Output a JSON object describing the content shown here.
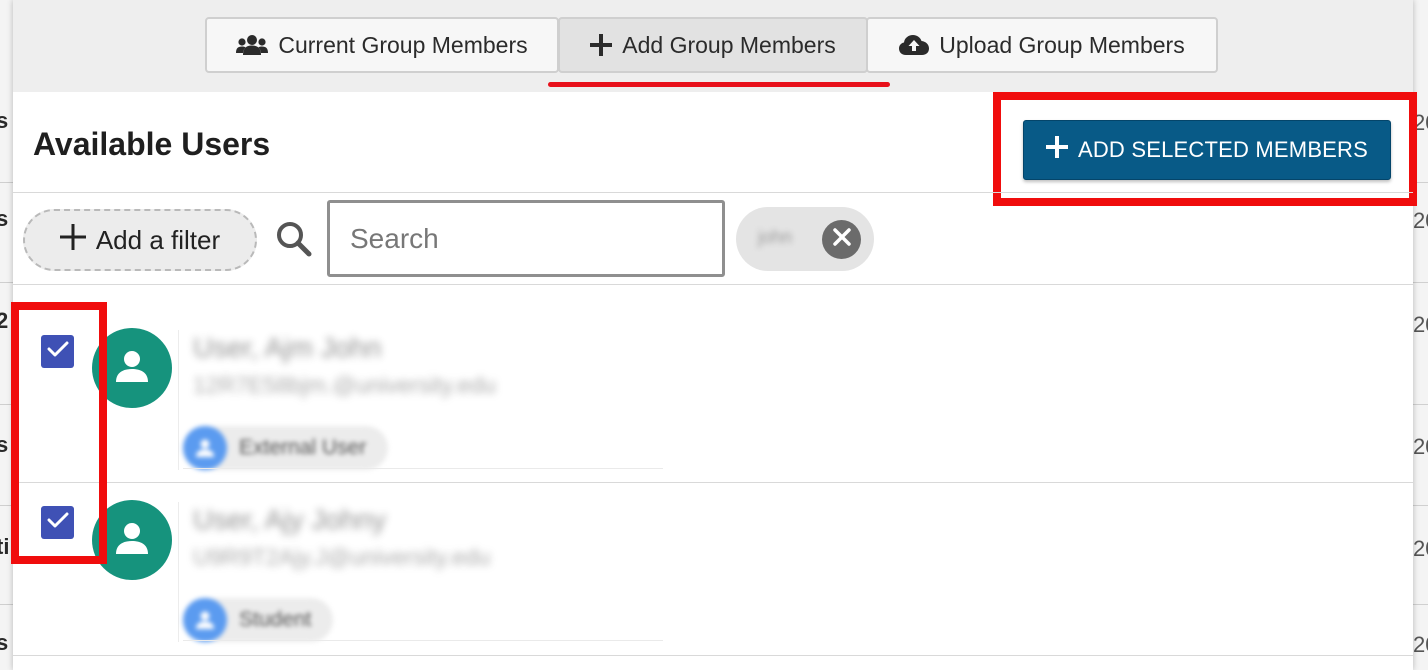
{
  "background": {
    "left_fragments": [
      "s",
      "s",
      "2",
      "s",
      "ti",
      "s"
    ],
    "right_fragments": [
      "20",
      "20",
      "20",
      "20",
      "20",
      "20"
    ]
  },
  "tabs": [
    {
      "label": "Current Group Members",
      "icon": "users-icon",
      "active": false
    },
    {
      "label": "Add Group Members",
      "icon": "plus-icon",
      "active": true
    },
    {
      "label": "Upload Group Members",
      "icon": "cloud-upload-icon",
      "active": false
    }
  ],
  "header": {
    "title": "Available Users",
    "add_selected_label": "ADD SELECTED MEMBERS"
  },
  "filters": {
    "add_filter_label": "Add a filter",
    "search_placeholder": "Search",
    "search_value": "",
    "chip_text": "john"
  },
  "users": [
    {
      "name": "User, Ajm John",
      "email": "12R7E58bjm.@university.edu",
      "role": "External User",
      "checked": true
    },
    {
      "name": "User, Ajy Johny",
      "email": "U9R9T2Ajy.J@university.edu",
      "role": "Student",
      "checked": true
    }
  ],
  "colors": {
    "accent_button": "#085a87",
    "checkbox": "#3f51b5",
    "avatar": "#16937d",
    "highlight": "#f00d0d",
    "role_icon": "#5b9bf0"
  }
}
